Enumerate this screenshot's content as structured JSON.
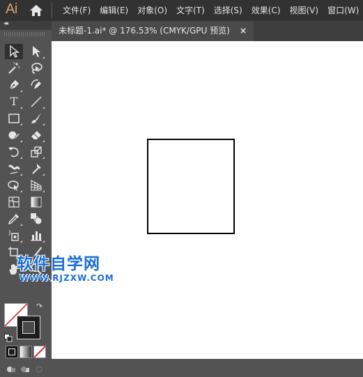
{
  "app": {
    "logo": "Ai"
  },
  "menu": [
    "文件(F)",
    "编辑(E)",
    "对象(O)",
    "文字(T)",
    "选择(S)",
    "效果(C)",
    "视图(V)",
    "窗口(W)"
  ],
  "document": {
    "tab_title": "未标题-1.ai* @ 176.53% (CMYK/GPU 预览)",
    "close_glyph": "×"
  },
  "tools": {
    "collapse_glyph": "◂◂",
    "type_glyph": "T",
    "icons": [
      "selection-tool-icon",
      "direct-selection-tool-icon",
      "magic-wand-tool-icon",
      "lasso-tool-icon",
      "pen-tool-icon",
      "curvature-tool-icon",
      "type-tool-icon",
      "line-segment-tool-icon",
      "rectangle-tool-icon",
      "paintbrush-tool-icon",
      "shaper-tool-icon",
      "eraser-tool-icon",
      "rotate-tool-icon",
      "scale-tool-icon",
      "width-tool-icon",
      "puppet-warp-tool-icon",
      "shape-builder-tool-icon",
      "perspective-grid-tool-icon",
      "mesh-tool-icon",
      "gradient-tool-icon",
      "eyedropper-tool-icon",
      "blend-tool-icon",
      "symbol-sprayer-tool-icon",
      "column-graph-tool-icon",
      "artboard-tool-icon",
      "slice-tool-icon",
      "hand-tool-icon",
      "zoom-tool-icon"
    ]
  },
  "colors": {
    "fill": "#ffffff",
    "stroke_none_line": "#e02020",
    "accent": "#d9a36b",
    "stroke": "#1e1e1e"
  },
  "watermark": {
    "title": "软件自学网",
    "url": "WWW.RJZXW.COM"
  }
}
